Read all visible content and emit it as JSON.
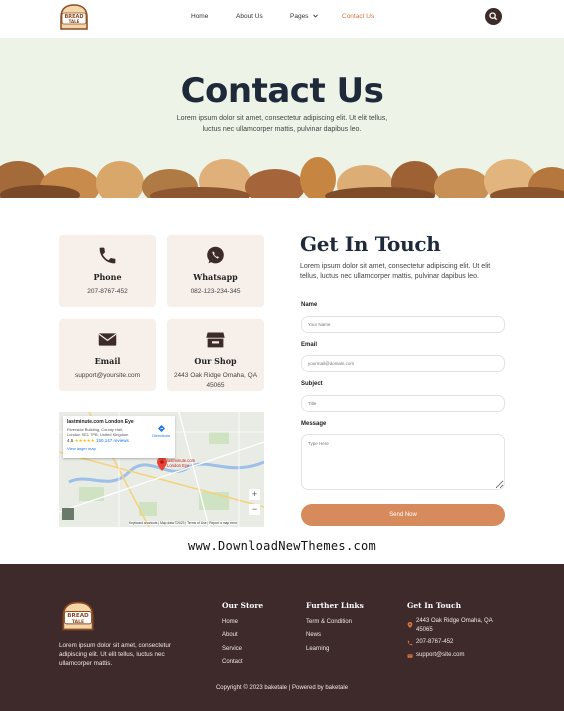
{
  "brand": {
    "logo_line1": "BREAD",
    "logo_line2": "TALE"
  },
  "nav": {
    "home": "Home",
    "about": "About Us",
    "pages": "Pages",
    "contact": "Contact Us"
  },
  "hero": {
    "title": "Contact Us",
    "text": "Lorem ipsum dolor sit amet, consectetur adipiscing elit. Ut elit tellus, luctus nec ullamcorper mattis, pulvinar dapibus leo."
  },
  "cards": [
    {
      "title": "Phone",
      "text": "207-8767-452"
    },
    {
      "title": "Whatsapp",
      "text": "082-123-234-345"
    },
    {
      "title": "Email",
      "text": "support@yoursite.com"
    },
    {
      "title": "Our Shop",
      "text": "2443 Oak Ridge Omaha, QA 45065"
    }
  ],
  "map": {
    "place_title": "lastminute.com London Eye",
    "place_address": "Riverside Building, County Hall, London SE1 7PB, United Kingdom",
    "rating": "4.5",
    "reviews": "150,147 reviews",
    "larger_map": "View larger map",
    "directions": "Directions",
    "pin_label": "lastminute.com London Eye",
    "footer": "Keyboard shortcuts | Map data ©2023 | Terms of Use | Report a map error",
    "zoom_in": "+",
    "zoom_out": "−"
  },
  "form": {
    "title": "Get In Touch",
    "text": "Lorem ipsum dolor sit amet, consectetur adipiscing elit. Ut elit tellus, luctus nec ullamcorper mattis, pulvinar dapibus leo.",
    "name_label": "Name",
    "name_placeholder": "Your Name",
    "email_label": "Email",
    "email_placeholder": "yourmail@domain.com",
    "subject_label": "Subject",
    "subject_placeholder": "Title",
    "message_label": "Message",
    "message_placeholder": "Type Here",
    "send_label": "Send Now"
  },
  "watermark": "www.DownloadNewThemes.com",
  "footer": {
    "about": "Lorem ipsum dolor sit amet, consectetur adipiscing elit. Ut elit tellus, luctus nec ullamcorper mattis.",
    "store_head": "Our Store",
    "store_links": [
      "Home",
      "About",
      "Service",
      "Contact"
    ],
    "links_head": "Further Links",
    "further_links": [
      "Term & Condition",
      "News",
      "Learning"
    ],
    "contact_head": "Get In Touch",
    "address": "2443 Oak Ridge Omaha, QA 45065",
    "phone": "207-8767-452",
    "email": "support@site.com",
    "copyright": "Copyright © 2023 baketale | Powered by baketale"
  },
  "colors": {
    "accent": "#d8743f",
    "dark": "#3e2a2b",
    "hero_bg": "#eef3e7",
    "card_bg": "#f7efea",
    "button": "#d78a5b",
    "navy": "#1e2a3a"
  }
}
